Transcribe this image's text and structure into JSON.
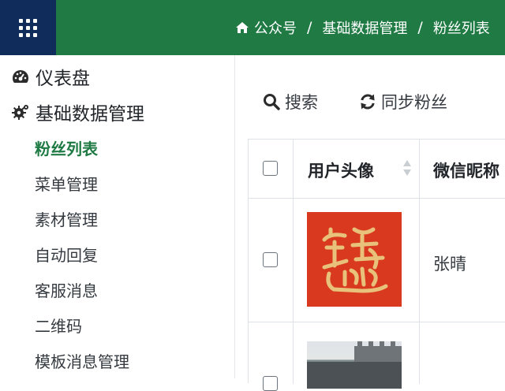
{
  "topbar": {
    "breadcrumb": {
      "items": [
        "公众号",
        "粉丝列表"
      ],
      "middle": "基础数据管理",
      "separator": "/"
    }
  },
  "sidebar": {
    "dashboard": "仪表盘",
    "base_data": "基础数据管理",
    "items": [
      "粉丝列表",
      "菜单管理",
      "素材管理",
      "自动回复",
      "客服消息",
      "二维码",
      "模板消息管理"
    ]
  },
  "toolbar": {
    "search": "搜索",
    "sync": "同步粉丝"
  },
  "table": {
    "headers": {
      "avatar": "用户头像",
      "nickname": "微信昵称"
    },
    "rows": [
      {
        "nickname": "张晴"
      }
    ]
  },
  "colors": {
    "topbar": "#1f7a44",
    "menu_button": "#0f2c5b",
    "active_item": "#1f7a44"
  }
}
